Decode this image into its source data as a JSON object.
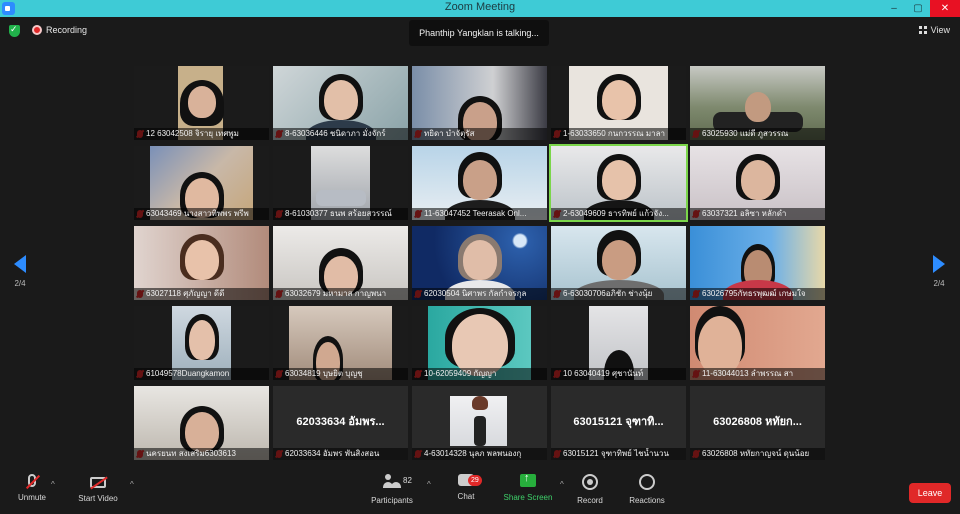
{
  "window": {
    "title": "Zoom Meeting",
    "controls": [
      "–",
      "▢",
      "✕"
    ]
  },
  "status": {
    "recording_label": "Recording",
    "talking_banner": "Phanthip Yangklan is talking...",
    "view_label": "View"
  },
  "navigation": {
    "page_indicator": "2/4"
  },
  "participants": [
    {
      "name": "12 63042508 จิรายุ เทศพูม"
    },
    {
      "name": "8-63036446 ชนิดาภา มั่งจักร์"
    },
    {
      "name": "ทยิดา บำจัตุรัส"
    },
    {
      "name": "1-63033650 กนกวรรณ มาลา"
    },
    {
      "name": "63025930 แม่ดี ภูสวรรณ"
    },
    {
      "name": "63043469 นางสาวทิพพร พรีพ"
    },
    {
      "name": "8-61030377 ธนพ สร้อยสวรรณ์"
    },
    {
      "name": "11-63047452 Teerasak Onl..."
    },
    {
      "name": "2-63049609 ธารทิพย์ แก้วจัง..."
    },
    {
      "name": "63037321 อลิซา หลักดำ"
    },
    {
      "name": "63027118 ศุภัญญา ดีดี"
    },
    {
      "name": "63032679 มหามาส กาญพนา"
    },
    {
      "name": "62030504 นิศาพร กัลกำจรกุล"
    },
    {
      "name": "6-63030706อภิชัก ช่างนุ้ย"
    },
    {
      "name": "63026795กัทธรพุฒฒ์ เกษมใจ"
    },
    {
      "name": "61049578Duangkamon"
    },
    {
      "name": "63034819 บุษยิต บุญชุ"
    },
    {
      "name": "10-62059409 กัญญา"
    },
    {
      "name": "10 63040419 ศุชานันท์"
    },
    {
      "name": "11-63044013 ลำพรรณ สา"
    },
    {
      "name": "นครยนท สงเสริม6303613"
    },
    {
      "name": "62033634 อัมพร พันสิงสอน",
      "big": "62033634 อัมพร..."
    },
    {
      "name": "4-63014328 นุลภ พลพนองกุ"
    },
    {
      "name": "63015121 จุฑาทิพย์ ไชน้ำนวน",
      "big": "63015121 จุฑาทิ..."
    },
    {
      "name": "63026808 หทัยกาญจน์ ดุนน้อย",
      "big": "63026808 หทัยก..."
    }
  ],
  "toolbar": {
    "unmute": "Unmute",
    "start_video": "Start Video",
    "participants": "Participants",
    "participants_count": "82",
    "chat": "Chat",
    "chat_badge": "29",
    "share_screen": "Share Screen",
    "record": "Record",
    "reactions": "Reactions",
    "leave": "Leave"
  }
}
